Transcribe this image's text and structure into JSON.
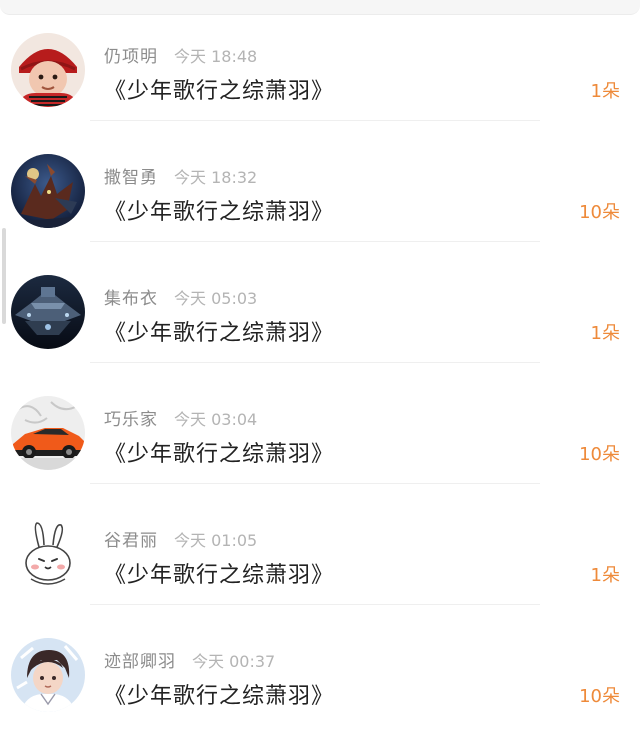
{
  "items": [
    {
      "name": "仍项明",
      "time": "今天 18:48",
      "title": "《少年歌行之综萧羽》",
      "count": "1朵",
      "avatar_icon": "child-in-red-hat-avatar",
      "avatar_colors": [
        "#f2e5dc",
        "#c61f1f",
        "#2a1a14"
      ]
    },
    {
      "name": "撒智勇",
      "time": "今天 18:32",
      "title": "《少年歌行之综萧羽》",
      "count": "10朵",
      "avatar_icon": "dragon-warrior-avatar",
      "avatar_colors": [
        "#14223d",
        "#7a3b2a",
        "#e9c27a"
      ]
    },
    {
      "name": "集布衣",
      "time": "今天 05:03",
      "title": "《少年歌行之综萧羽》",
      "count": "1朵",
      "avatar_icon": "spaceship-avatar",
      "avatar_colors": [
        "#0f1a2a",
        "#4f6a86",
        "#a8c6e0"
      ]
    },
    {
      "name": "巧乐家",
      "time": "今天 03:04",
      "title": "《少年歌行之综萧羽》",
      "count": "10朵",
      "avatar_icon": "orange-sports-car-avatar",
      "avatar_colors": [
        "#efefef",
        "#f05a1a",
        "#222222"
      ]
    },
    {
      "name": "谷君丽",
      "time": "今天 01:05",
      "title": "《少年歌行之综萧羽》",
      "count": "1朵",
      "avatar_icon": "cartoon-rabbit-avatar",
      "avatar_colors": [
        "#ffffff",
        "#333333",
        "#f3a9a9"
      ]
    },
    {
      "name": "迹部卿羽",
      "time": "今天 00:37",
      "title": "《少年歌行之综萧羽》",
      "count": "10朵",
      "avatar_icon": "anime-boy-avatar",
      "avatar_colors": [
        "#cfe0f3",
        "#3a2a2a",
        "#f3d2c0"
      ]
    }
  ],
  "accent_color": "#ee8a3a",
  "scroll_icon": "scrollbar-indicator"
}
